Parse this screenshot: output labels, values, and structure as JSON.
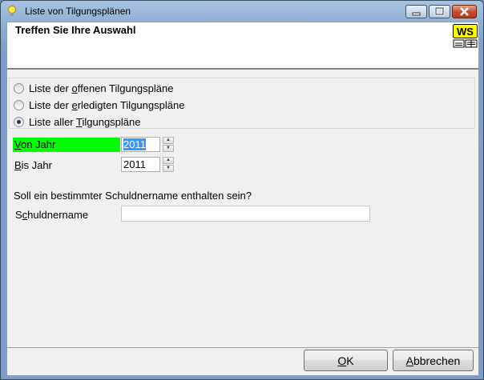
{
  "window": {
    "title": "Liste von Tilgungsplänen",
    "icon": "lightbulb-icon"
  },
  "header": {
    "title": "Treffen Sie Ihre Auswahl",
    "logo_text": "WS"
  },
  "options": [
    {
      "pre": "Liste der ",
      "key": "o",
      "post": "ffenen Tilgungspläne",
      "checked": false
    },
    {
      "pre": "Liste der ",
      "key": "e",
      "post": "rledigten Tilgungspläne",
      "checked": false
    },
    {
      "pre": "Liste aller ",
      "key": "T",
      "post": "ilgungspläne",
      "checked": true
    }
  ],
  "fields": {
    "von_jahr": {
      "key": "V",
      "rest": "on Jahr",
      "value": "2011"
    },
    "bis_jahr": {
      "key": "B",
      "rest": "is Jahr",
      "value": "2011"
    }
  },
  "question": "Soll ein bestimmter Schuldnername enthalten sein?",
  "schuldner": {
    "pre": "S",
    "key": "c",
    "post": "huldnername",
    "value": ""
  },
  "buttons": {
    "ok": {
      "key": "O",
      "rest": "K"
    },
    "cancel": {
      "key": "A",
      "rest": "bbrechen"
    }
  },
  "colors": {
    "highlight": "#00ff00",
    "selection": "#3399ff"
  }
}
